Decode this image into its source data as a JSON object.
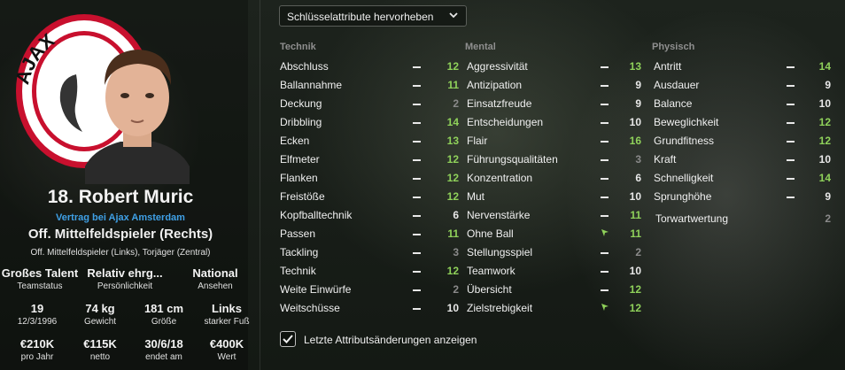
{
  "player": {
    "name": "18. Robert Muric",
    "contract": "Vertrag bei Ajax Amsterdam",
    "position": "Off. Mittelfeldspieler (Rechts)",
    "secondary_positions": "Off. Mittelfeldspieler (Links), Torjäger (Zentral)"
  },
  "info_rows": [
    [
      {
        "value": "Großes Talent",
        "label": "Teamstatus"
      },
      {
        "value": "Relativ ehrg...",
        "label": "Persönlichkeit"
      },
      {
        "value": "National",
        "label": "Ansehen"
      }
    ],
    [
      {
        "value": "19",
        "label": "12/3/1996"
      },
      {
        "value": "74 kg",
        "label": "Gewicht"
      },
      {
        "value": "181 cm",
        "label": "Größe"
      },
      {
        "value": "Links",
        "label": "starker Fuß"
      }
    ],
    [
      {
        "value": "€210K",
        "label": "pro Jahr"
      },
      {
        "value": "€115K",
        "label": "netto"
      },
      {
        "value": "30/6/18",
        "label": "endet am"
      },
      {
        "value": "€400K",
        "label": "Wert"
      }
    ]
  ],
  "dropdown": {
    "label": "Schlüsselattribute hervorheben"
  },
  "columns": {
    "technik": {
      "title": "Technik",
      "items": [
        {
          "name": "Abschluss",
          "value": "12",
          "trend": "dash",
          "level": "hi"
        },
        {
          "name": "Ballannahme",
          "value": "11",
          "trend": "dash",
          "level": "hi"
        },
        {
          "name": "Deckung",
          "value": "2",
          "trend": "dash",
          "level": "lo"
        },
        {
          "name": "Dribbling",
          "value": "14",
          "trend": "dash",
          "level": "hi"
        },
        {
          "name": "Ecken",
          "value": "13",
          "trend": "dash",
          "level": "hi"
        },
        {
          "name": "Elfmeter",
          "value": "12",
          "trend": "dash",
          "level": "hi"
        },
        {
          "name": "Flanken",
          "value": "12",
          "trend": "dash",
          "level": "hi"
        },
        {
          "name": "Freistöße",
          "value": "12",
          "trend": "dash",
          "level": "hi"
        },
        {
          "name": "Kopfballtechnik",
          "value": "6",
          "trend": "dash",
          "level": "mid"
        },
        {
          "name": "Passen",
          "value": "11",
          "trend": "dash",
          "level": "hi"
        },
        {
          "name": "Tackling",
          "value": "3",
          "trend": "dash",
          "level": "lo"
        },
        {
          "name": "Technik",
          "value": "12",
          "trend": "dash",
          "level": "hi"
        },
        {
          "name": "Weite Einwürfe",
          "value": "2",
          "trend": "dash",
          "level": "lo"
        },
        {
          "name": "Weitschüsse",
          "value": "10",
          "trend": "dash",
          "level": "mid"
        }
      ]
    },
    "mental": {
      "title": "Mental",
      "items": [
        {
          "name": "Aggressivität",
          "value": "13",
          "trend": "dash",
          "level": "hi"
        },
        {
          "name": "Antizipation",
          "value": "9",
          "trend": "dash",
          "level": "mid"
        },
        {
          "name": "Einsatzfreude",
          "value": "9",
          "trend": "dash",
          "level": "mid"
        },
        {
          "name": "Entscheidungen",
          "value": "10",
          "trend": "dash",
          "level": "mid"
        },
        {
          "name": "Flair",
          "value": "16",
          "trend": "dash",
          "level": "hi"
        },
        {
          "name": "Führungsqualitäten",
          "value": "3",
          "trend": "dash",
          "level": "lo"
        },
        {
          "name": "Konzentration",
          "value": "6",
          "trend": "dash",
          "level": "mid"
        },
        {
          "name": "Mut",
          "value": "10",
          "trend": "dash",
          "level": "mid"
        },
        {
          "name": "Nervenstärke",
          "value": "11",
          "trend": "dash",
          "level": "hi"
        },
        {
          "name": "Ohne Ball",
          "value": "11",
          "trend": "up",
          "level": "hi"
        },
        {
          "name": "Stellungsspiel",
          "value": "2",
          "trend": "dash",
          "level": "lo"
        },
        {
          "name": "Teamwork",
          "value": "10",
          "trend": "dash",
          "level": "mid"
        },
        {
          "name": "Übersicht",
          "value": "12",
          "trend": "dash",
          "level": "hi"
        },
        {
          "name": "Zielstrebigkeit",
          "value": "12",
          "trend": "up",
          "level": "hi"
        }
      ]
    },
    "physisch": {
      "title": "Physisch",
      "items": [
        {
          "name": "Antritt",
          "value": "14",
          "trend": "dash",
          "level": "hi"
        },
        {
          "name": "Ausdauer",
          "value": "9",
          "trend": "dash",
          "level": "mid"
        },
        {
          "name": "Balance",
          "value": "10",
          "trend": "dash",
          "level": "mid"
        },
        {
          "name": "Beweglichkeit",
          "value": "12",
          "trend": "dash",
          "level": "hi"
        },
        {
          "name": "Grundfitness",
          "value": "12",
          "trend": "dash",
          "level": "hi"
        },
        {
          "name": "Kraft",
          "value": "10",
          "trend": "dash",
          "level": "mid"
        },
        {
          "name": "Schnelligkeit",
          "value": "14",
          "trend": "dash",
          "level": "hi"
        },
        {
          "name": "Sprunghöhe",
          "value": "9",
          "trend": "dash",
          "level": "mid"
        }
      ],
      "extra": {
        "name": "Torwartwertung",
        "value": "2",
        "level": "lo"
      }
    }
  },
  "checkbox": {
    "label": "Letzte Attributsänderungen anzeigen",
    "checked": true
  },
  "colors": {
    "high": "#8fd15a",
    "normal": "#e8e8e8",
    "low": "#8a8a8a",
    "link": "#3fa0e6"
  },
  "logo": {
    "text": "AJAX",
    "colors": [
      "#c8102e",
      "#ffffff",
      "#111111"
    ]
  }
}
